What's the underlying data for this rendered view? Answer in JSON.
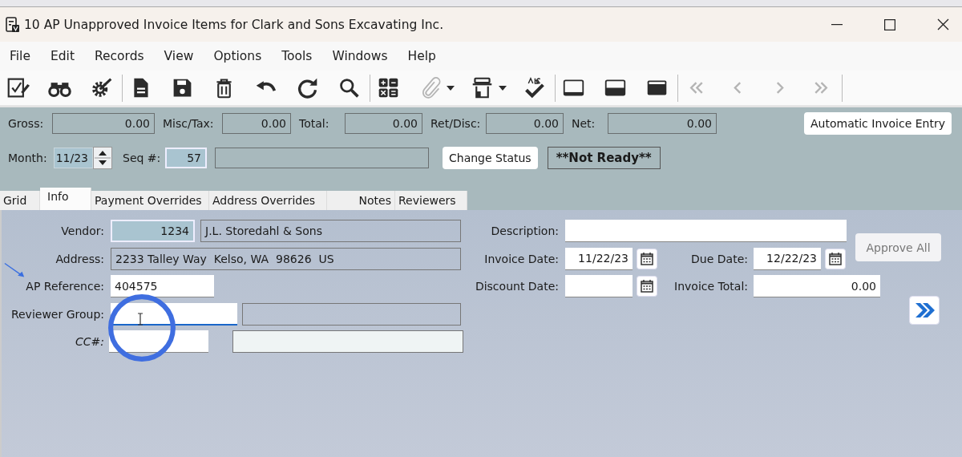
{
  "window": {
    "title": "10 AP Unapproved Invoice Items for Clark and Sons Excavating Inc."
  },
  "menu": [
    "File",
    "Edit",
    "Records",
    "View",
    "Options",
    "Tools",
    "Windows",
    "Help"
  ],
  "toolbar": [
    {
      "disabled": false
    },
    {
      "disabled": false
    },
    {
      "disabled": false
    },
    {
      "disabled": false
    },
    {
      "disabled": false
    },
    {
      "disabled": false
    },
    {
      "disabled": false
    },
    {
      "disabled": false
    },
    {
      "disabled": false
    },
    {
      "disabled": false
    },
    {
      "disabled": true
    },
    {
      "disabled": false
    },
    {
      "disabled": false
    },
    {
      "disabled": false
    },
    {
      "disabled": false
    },
    {
      "disabled": false
    },
    {
      "disabled": false
    },
    {
      "disabled": false
    },
    {
      "disabled": true
    },
    {
      "disabled": true
    },
    {
      "disabled": true
    },
    {
      "disabled": true
    }
  ],
  "totals": [
    {
      "label": "Gross:",
      "value": "0.00"
    },
    {
      "label": "Misc/Tax:",
      "value": "0.00"
    },
    {
      "label": "Total:",
      "value": "0.00"
    },
    {
      "label": "Ret/Disc:",
      "value": "0.00"
    },
    {
      "label": "Net:",
      "value": "0.00"
    }
  ],
  "automatic_invoice_button": "Automatic Invoice Entry",
  "month": {
    "label": "Month:",
    "value": "11/23"
  },
  "seq": {
    "label": "Seq #:",
    "value": "57"
  },
  "change_status_button": "Change Status",
  "status": "**Not Ready**",
  "tabs": [
    {
      "label": "Grid",
      "selected": false
    },
    {
      "label": "Info",
      "selected": true
    },
    {
      "label": "Payment Overrides",
      "selected": false
    },
    {
      "label": "Address Overrides",
      "selected": false
    },
    {
      "label": "Notes",
      "selected": false
    },
    {
      "label": "Reviewers",
      "selected": false
    }
  ],
  "info": {
    "vendor": {
      "label": "Vendor:",
      "value": "1234",
      "name": "J.L. Storedahl & Sons"
    },
    "address": {
      "label": "Address:",
      "value": "2233 Talley Way  Kelso, WA  98626  US"
    },
    "ap_reference": {
      "label": "AP Reference:",
      "value": "404575"
    },
    "reviewer_group": {
      "label": "Reviewer Group:"
    },
    "cc": {
      "label": "CC#:"
    },
    "description": {
      "label": "Description:"
    },
    "invoice_date": {
      "label": "Invoice Date:",
      "value": "11/22/23"
    },
    "due_date": {
      "label": "Due Date:",
      "value": "12/22/23"
    },
    "discount_date": {
      "label": "Discount Date:"
    },
    "invoice_total": {
      "label": "Invoice Total:",
      "value": "0.00"
    },
    "approve_all_button": {
      "label": "Approve All",
      "disabled": true
    }
  }
}
